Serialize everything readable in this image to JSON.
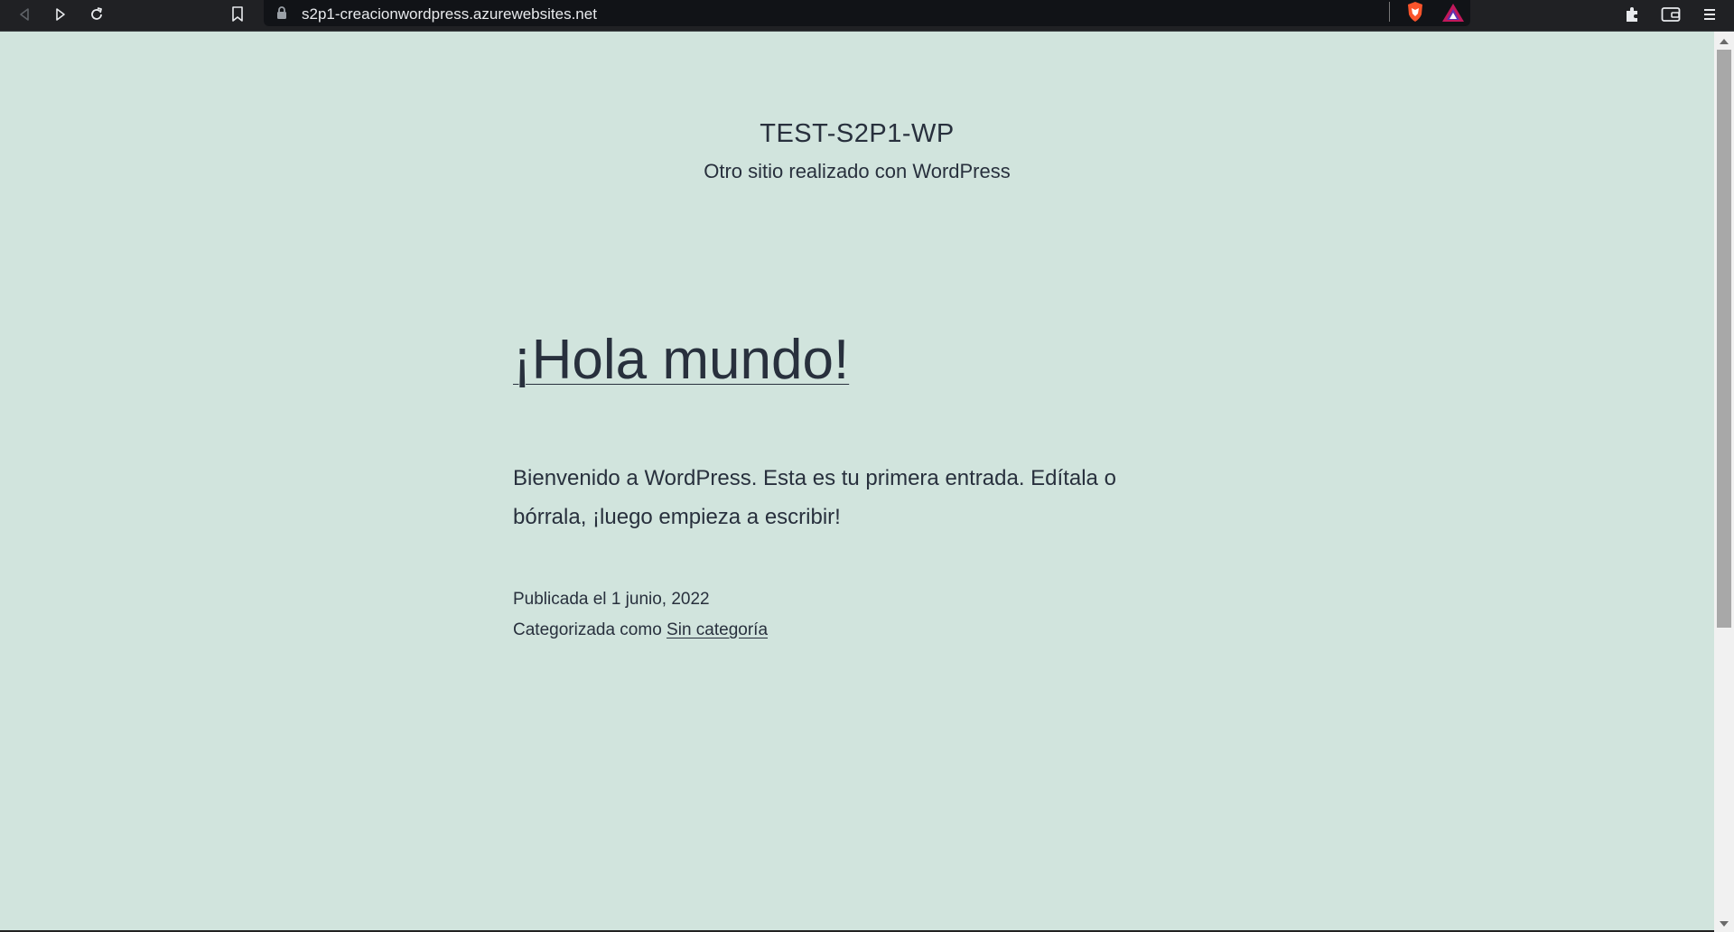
{
  "browser": {
    "url": "s2p1-creacionwordpress.azurewebsites.net",
    "icons": [
      "back-icon",
      "forward-icon",
      "reload-icon",
      "bookmark-icon",
      "lock-icon",
      "brave-shields-icon",
      "brave-rewards-icon",
      "extensions-icon",
      "wallet-icon",
      "menu-icon"
    ]
  },
  "site": {
    "title": "TEST-S2P1-WP",
    "description": "Otro sitio realizado con WordPress"
  },
  "post": {
    "title": "¡Hola mundo!",
    "body": "Bienvenido a WordPress. Esta es tu primera entrada. Edítala o bórrala, ¡luego empieza a escribir!",
    "published_label": "Publicada el",
    "published_date": "1 junio, 2022",
    "category_label": "Categorizada como",
    "category": "Sin categoría"
  },
  "colors": {
    "page_background": "#d1e4dd",
    "text": "#28303d",
    "toolbar": "#202124"
  }
}
